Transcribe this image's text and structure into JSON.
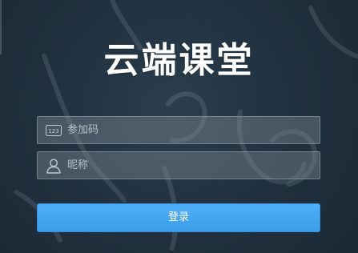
{
  "app": {
    "logo_text": "云端课堂"
  },
  "form": {
    "class_code": {
      "placeholder": "参加码",
      "value": "",
      "icon": "number-123-icon",
      "icon_text": "123"
    },
    "nickname": {
      "placeholder": "昵称",
      "value": "",
      "icon": "user-icon"
    },
    "login_label": "登录"
  },
  "colors": {
    "background": "#213240",
    "button": "#41a3ee",
    "field_background": "#5e6a74",
    "text": "#ffffff"
  }
}
